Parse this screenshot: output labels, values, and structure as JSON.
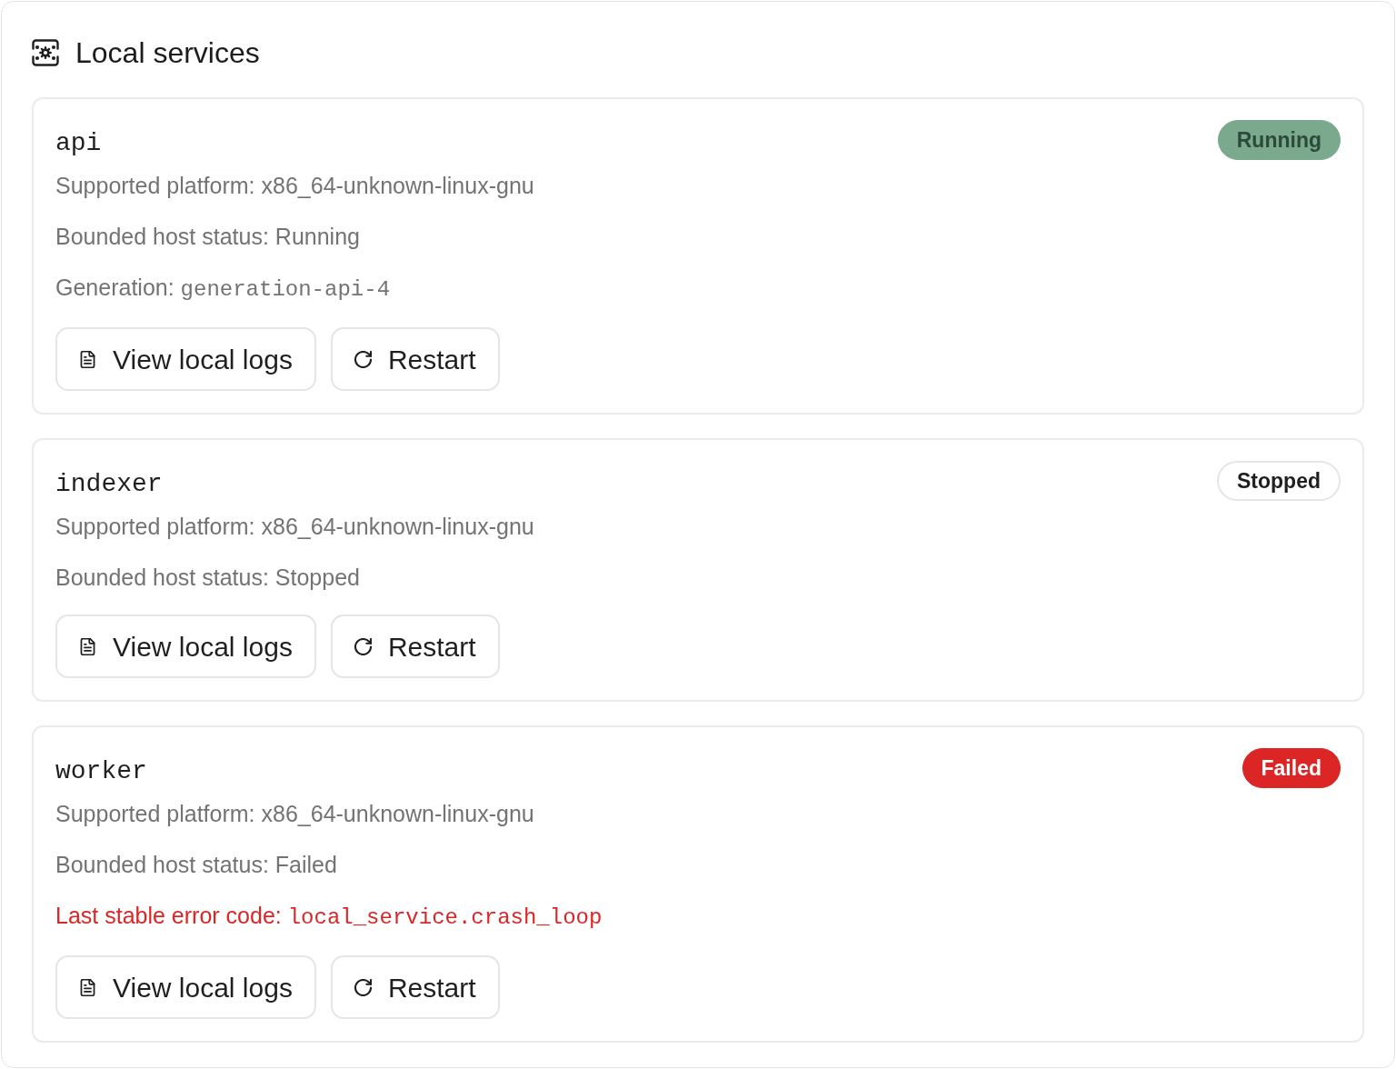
{
  "section": {
    "title": "Local services"
  },
  "services": [
    {
      "name": "api",
      "status": {
        "label": "Running",
        "kind": "running"
      },
      "details": [
        {
          "kind": "text",
          "label": "Supported platform: x86_64-unknown-linux-gnu"
        },
        {
          "kind": "text",
          "label": "Bounded host status: Running"
        },
        {
          "kind": "code",
          "label": "Generation:",
          "value": "generation-api-4"
        }
      ],
      "buttons": [
        {
          "label": "View local logs",
          "kind": "logs"
        },
        {
          "label": "Restart",
          "kind": "restart"
        }
      ]
    },
    {
      "name": "indexer",
      "status": {
        "label": "Stopped",
        "kind": "stopped"
      },
      "details": [
        {
          "kind": "text",
          "label": "Supported platform: x86_64-unknown-linux-gnu"
        },
        {
          "kind": "text",
          "label": "Bounded host status: Stopped"
        }
      ],
      "buttons": [
        {
          "label": "View local logs",
          "kind": "logs"
        },
        {
          "label": "Restart",
          "kind": "restart"
        }
      ]
    },
    {
      "name": "worker",
      "status": {
        "label": "Failed",
        "kind": "failed"
      },
      "details": [
        {
          "kind": "text",
          "label": "Supported platform: x86_64-unknown-linux-gnu"
        },
        {
          "kind": "text",
          "label": "Bounded host status: Failed"
        },
        {
          "kind": "error",
          "label": "Last stable error code:",
          "value": "local_service.crash_loop"
        }
      ],
      "buttons": [
        {
          "label": "View local logs",
          "kind": "logs"
        },
        {
          "label": "Restart",
          "kind": "restart"
        }
      ]
    }
  ]
}
